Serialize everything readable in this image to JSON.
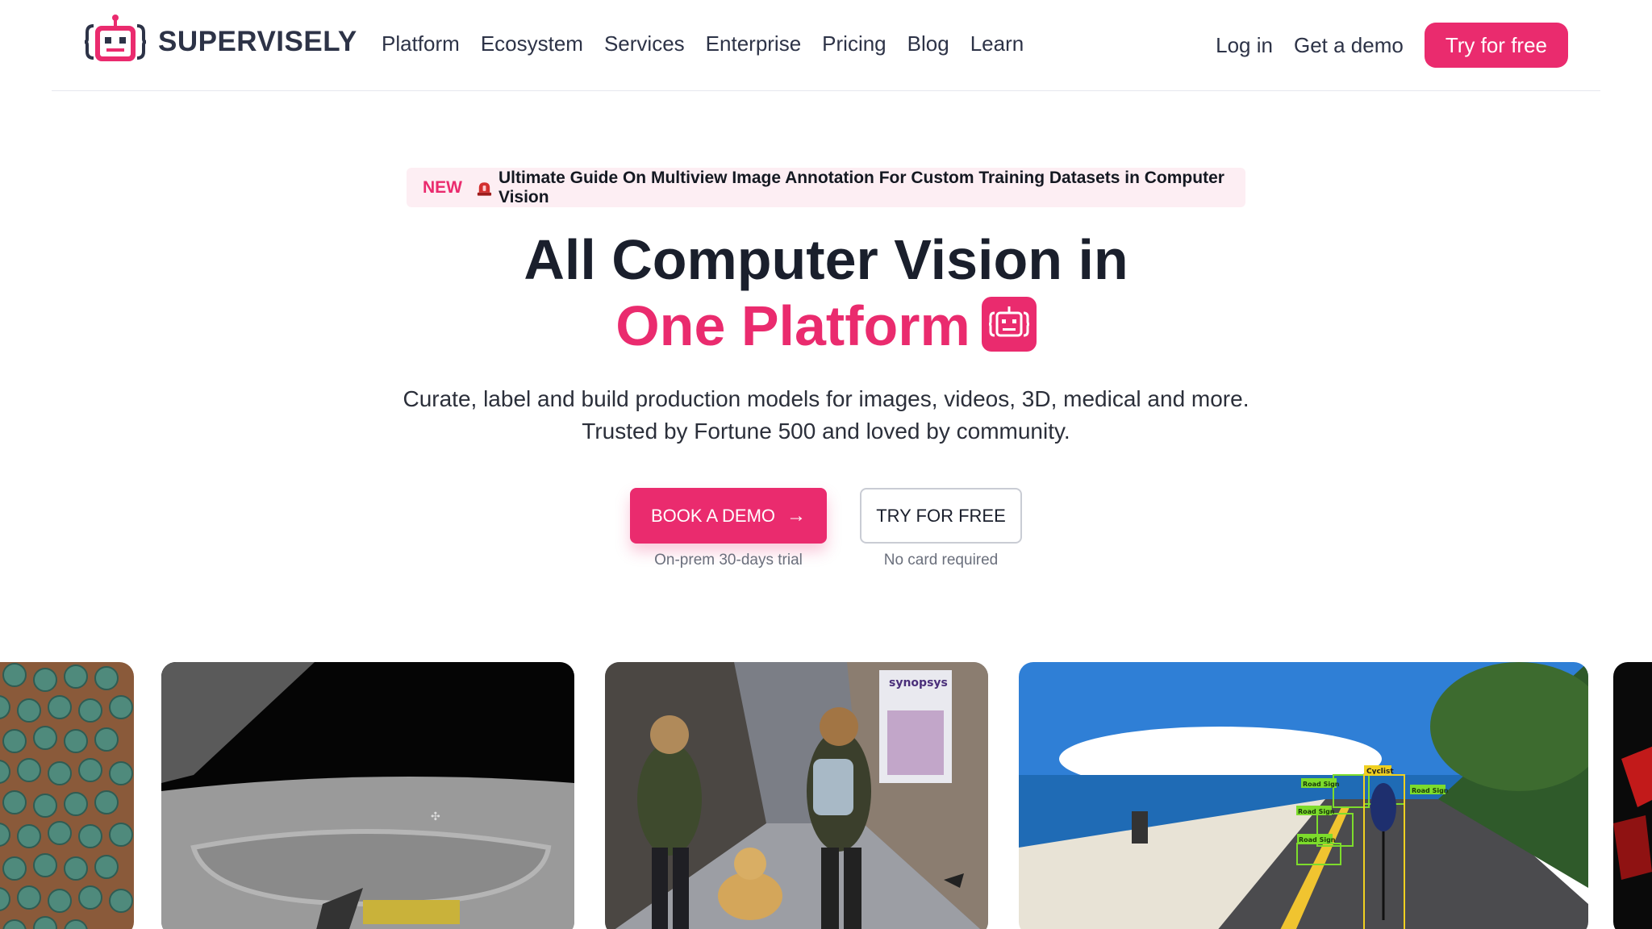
{
  "brand": {
    "name": "SUPERVISELY"
  },
  "nav": {
    "links": [
      "Platform",
      "Ecosystem",
      "Services",
      "Enterprise",
      "Pricing",
      "Blog",
      "Learn"
    ],
    "login": "Log in",
    "demo": "Get a demo",
    "try": "Try for free"
  },
  "banner": {
    "tag": "NEW",
    "text": "Ultimate Guide On Multiview Image Annotation For Custom Training Datasets in Computer Vision"
  },
  "hero": {
    "title_line1": "All Computer Vision in",
    "title_line2": "One Platform",
    "subtitle_line1": "Curate, label and build production models for images, videos, 3D, medical and more.",
    "subtitle_line2": "Trusted by Fortune 500 and loved by community."
  },
  "cta": {
    "demo_label": "BOOK A DEMO",
    "demo_caption": "On-prem 30-days trial",
    "free_label": "TRY FOR FREE",
    "free_caption": "No card required"
  },
  "gallery": {
    "annotations": [
      "Cyclist",
      "Road Sign",
      "Road Sign",
      "Road Sign",
      "Road Sign"
    ],
    "billboard": "synopsys"
  },
  "colors": {
    "accent": "#ea2b6e",
    "text": "#1a1f2c"
  }
}
